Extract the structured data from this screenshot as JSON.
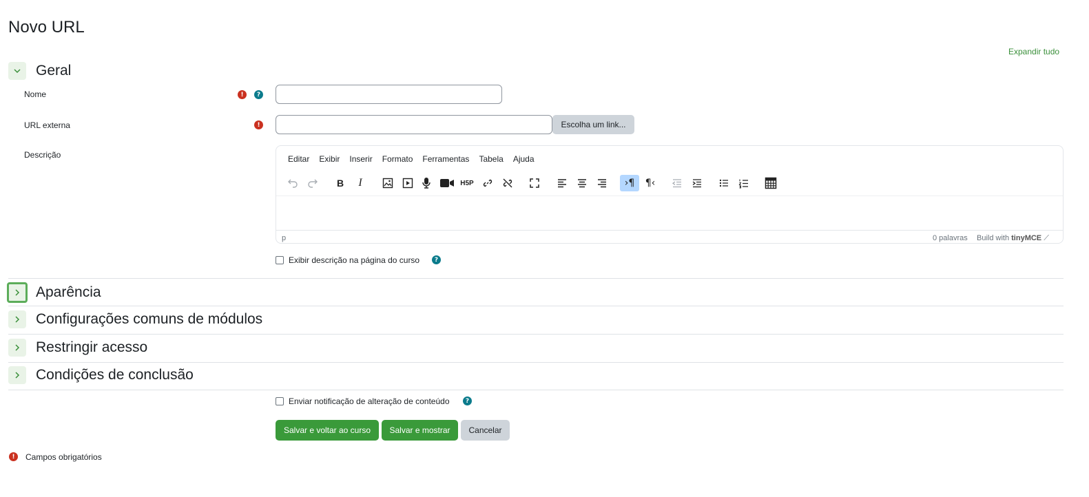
{
  "page": {
    "title": "Novo URL",
    "expand_all": "Expandir tudo"
  },
  "sections": {
    "general": "Geral",
    "appearance": "Aparência",
    "common_modules": "Configurações comuns de módulos",
    "restrict_access": "Restringir acesso",
    "completion": "Condições de conclusão"
  },
  "fields": {
    "name": {
      "label": "Nome",
      "value": ""
    },
    "external_url": {
      "label": "URL externa",
      "value": "",
      "choose_link_button": "Escolha um link..."
    },
    "description": {
      "label": "Descrição"
    }
  },
  "editor": {
    "menu": [
      "Editar",
      "Exibir",
      "Inserir",
      "Formato",
      "Ferramentas",
      "Tabela",
      "Ajuda"
    ],
    "toolbar_icons": [
      "undo-icon",
      "redo-icon",
      "bold-icon",
      "italic-icon",
      "image-icon",
      "media-icon",
      "record-audio-icon",
      "record-video-icon",
      "h5p-icon",
      "link-icon",
      "unlink-icon",
      "fullscreen-icon",
      "align-left-icon",
      "align-center-icon",
      "align-right-icon",
      "ltr-icon",
      "rtl-icon",
      "outdent-icon",
      "indent-icon",
      "bullet-list-icon",
      "numbered-list-icon",
      "table-icon"
    ],
    "status_path": "p",
    "word_count": "0 palavras",
    "brand_prefix": "Build with",
    "brand_name": "tinyMCE"
  },
  "show_description": {
    "label": "Exibir descrição na página do curso",
    "checked": false
  },
  "notify": {
    "label": "Enviar notificação de alteração de conteúdo",
    "checked": false
  },
  "buttons": {
    "save_return": "Salvar e voltar ao curso",
    "save_display": "Salvar e mostrar",
    "cancel": "Cancelar"
  },
  "required_note": "Campos obrigatórios",
  "colors": {
    "primary": "#3a9a3a",
    "required": "#ca3120",
    "help": "#0b7b8c",
    "secondary": "#ced4da"
  }
}
